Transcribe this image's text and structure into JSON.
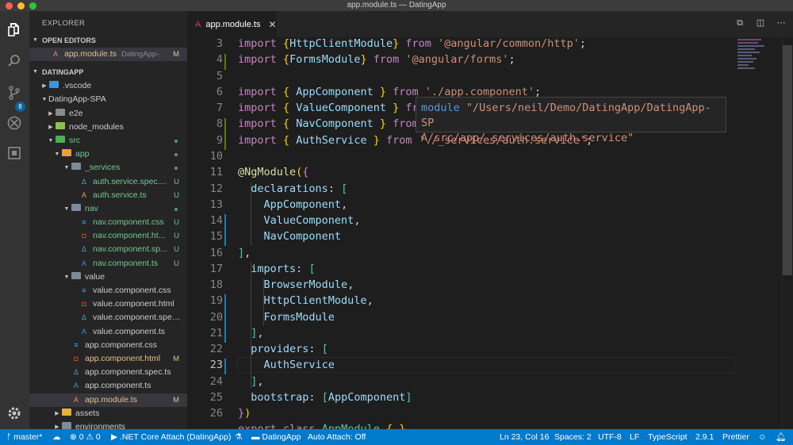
{
  "window": {
    "title": "app.module.ts — DatingApp"
  },
  "activity_bar": {
    "scm_badge": "8"
  },
  "sidebar": {
    "title": "EXPLORER",
    "open_editors_label": "OPEN EDITORS",
    "open_editor": {
      "name": "app.module.ts",
      "folder": "DatingApp-...",
      "status": "M"
    },
    "workspace_label": "DATINGAPP",
    "tree": [
      {
        "name": ".vscode",
        "status": ""
      },
      {
        "name": "DatingApp-SPA",
        "status": ""
      },
      {
        "name": "e2e",
        "status": ""
      },
      {
        "name": "node_modules",
        "status": ""
      },
      {
        "name": "src",
        "status": ""
      },
      {
        "name": "app",
        "status": ""
      },
      {
        "name": "_services",
        "status": ""
      },
      {
        "name": "auth.service.spec....",
        "status": "U"
      },
      {
        "name": "auth.service.ts",
        "status": "U"
      },
      {
        "name": "nav",
        "status": ""
      },
      {
        "name": "nav.component.css",
        "status": "U"
      },
      {
        "name": "nav.component.ht...",
        "status": "U"
      },
      {
        "name": "nav.component.sp...",
        "status": "U"
      },
      {
        "name": "nav.component.ts",
        "status": "U"
      },
      {
        "name": "value",
        "status": ""
      },
      {
        "name": "value.component.css",
        "status": ""
      },
      {
        "name": "value.component.html",
        "status": ""
      },
      {
        "name": "value.component.spec....",
        "status": ""
      },
      {
        "name": "value.component.ts",
        "status": ""
      },
      {
        "name": "app.component.css",
        "status": ""
      },
      {
        "name": "app.component.html",
        "status": "M"
      },
      {
        "name": "app.component.spec.ts",
        "status": ""
      },
      {
        "name": "app.component.ts",
        "status": ""
      },
      {
        "name": "app.module.ts",
        "status": "M"
      },
      {
        "name": "assets",
        "status": ""
      },
      {
        "name": "environments",
        "status": ""
      }
    ]
  },
  "tab": {
    "label": "app.module.ts",
    "close": "✕"
  },
  "editor": {
    "current_line": 23,
    "line_numbers": [
      "3",
      "4",
      "5",
      "6",
      "7",
      "8",
      "9",
      "10",
      "11",
      "12",
      "13",
      "14",
      "15",
      "16",
      "17",
      "18",
      "19",
      "20",
      "21",
      "22",
      "23",
      "24",
      "25",
      "26"
    ],
    "hover": {
      "keyword": "module",
      "path_line1": "\"/Users/neil/Demo/DatingApp/DatingApp-SP",
      "path_line2": "A/src/app/_services/auth.service\""
    }
  },
  "status_bar": {
    "branch": "master*",
    "errors": "0",
    "warnings": "0",
    "debug": ".NET Core Attach (DatingApp)",
    "folder": "DatingApp",
    "auto_attach": "Auto Attach: Off",
    "cursor": "Ln 23, Col 16",
    "spaces": "Spaces: 2",
    "encoding": "UTF-8",
    "eol": "LF",
    "language": "TypeScript",
    "ts_version": "2.9.1",
    "formatter": "Prettier"
  }
}
